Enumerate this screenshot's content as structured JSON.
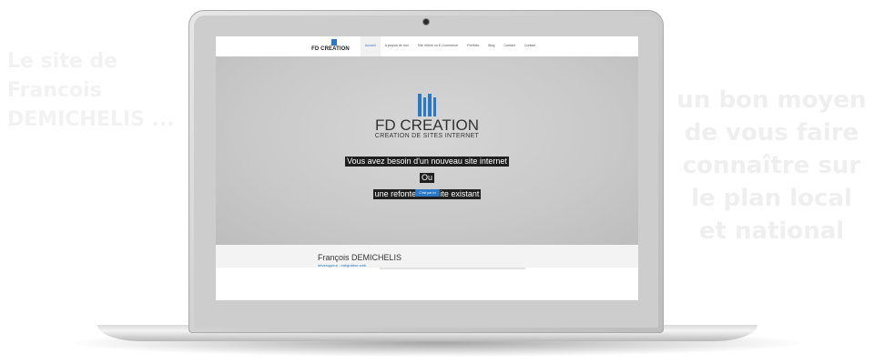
{
  "background": {
    "left_text": [
      "Le site de Francois",
      "DEMICHELIS ..."
    ],
    "right_text": [
      "un bon moyen",
      "de vous faire",
      "connaître sur",
      "le plan local",
      "et national"
    ]
  },
  "site": {
    "logo_text": "FD CREATION",
    "nav": [
      {
        "label": "Accueil",
        "active": true
      },
      {
        "label": "A propos de moi"
      },
      {
        "label": "Site Vitrine ou E-Commerce"
      },
      {
        "label": "Portfolio"
      },
      {
        "label": "Blog"
      },
      {
        "label": "Contact"
      },
      {
        "label": "Contact"
      }
    ],
    "hero": {
      "title": "FD CREATION",
      "subtitle": "CREATION DE SITES INTERNET",
      "lines": [
        "Vous avez besoin d'un nouveau site internet",
        "Ou",
        "une refonte d'un site existant"
      ],
      "button_label": "C'est par ici"
    },
    "profile": {
      "name": "François DEMICHELIS",
      "role": "développeur - intégrateur web"
    }
  },
  "colors": {
    "accent": "#2a78c6",
    "hero_bg": "#c9c9c9",
    "laptop_silver": "#cfcfcf"
  }
}
